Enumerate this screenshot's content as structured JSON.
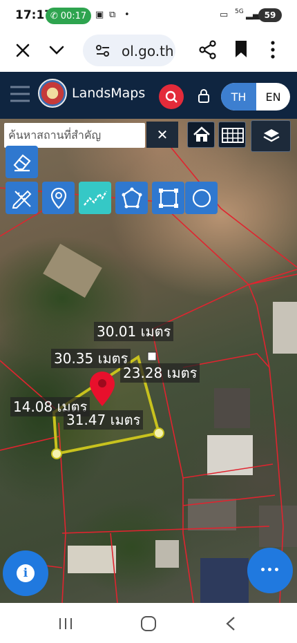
{
  "status_bar": {
    "time": "17:17",
    "call_duration": "00:17",
    "network": "5G",
    "battery": "59"
  },
  "browser": {
    "url": "ol.go.th"
  },
  "app": {
    "name": "LandsMaps",
    "lang_th": "TH",
    "lang_en": "EN"
  },
  "map": {
    "search_placeholder": "ค้นหาสถานที่สำคัญ",
    "close_glyph": "✕",
    "measurements": [
      {
        "label": "30.01 เมตร"
      },
      {
        "label": "30.35 เมตร"
      },
      {
        "label": "23.28 เมตร"
      },
      {
        "label": "14.08 เมตร"
      },
      {
        "label": "31.47 เมตร"
      }
    ],
    "colors": {
      "parcel_border": "#e0242f",
      "measure_polygon": "#c8c21e",
      "pin": "#e8102c"
    }
  },
  "fabs": {
    "info_glyph": "i",
    "more_glyph": "•••"
  }
}
